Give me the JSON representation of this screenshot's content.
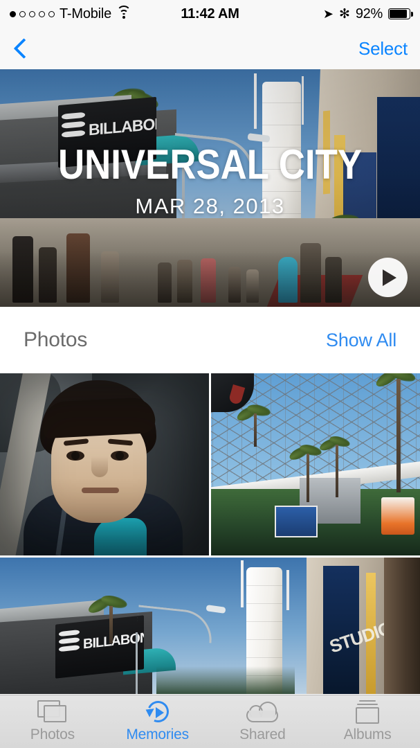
{
  "status_bar": {
    "signal_dots_total": 5,
    "signal_dots_filled": 1,
    "carrier": "T-Mobile",
    "wifi_icon": "wifi-icon",
    "time": "11:42 AM",
    "location_icon": "location-arrow-icon",
    "bluetooth_icon": "bluetooth-icon",
    "battery_percent": "92%",
    "battery_level": 92
  },
  "nav_bar": {
    "back_icon": "chevron-left-icon",
    "select_label": "Select"
  },
  "hero": {
    "title": "UNIVERSAL CITY",
    "date": "MAR 28, 2013",
    "play_icon": "play-icon",
    "sign_text": "BILLABONG"
  },
  "section": {
    "title": "Photos",
    "show_all_label": "Show All"
  },
  "grid": {
    "rows": [
      {
        "tiles": [
          {
            "name": "photo-portrait-selfie",
            "alt": "Portrait selfie in car"
          },
          {
            "name": "photo-geodesic-dome",
            "alt": "Geodesic dome and palm trees"
          }
        ]
      },
      {
        "tiles": [
          {
            "name": "photo-universal-citywalk",
            "alt": "Billabong store and Universal Studios sign"
          }
        ]
      }
    ],
    "tile3_sign_text": "BILLABONG",
    "tile3_studio_text": "STUDIO"
  },
  "tab_bar": {
    "tabs": [
      {
        "label": "Photos",
        "icon": "photos-stack-icon",
        "active": false
      },
      {
        "label": "Memories",
        "icon": "memories-replay-icon",
        "active": true
      },
      {
        "label": "Shared",
        "icon": "cloud-icon",
        "active": false
      },
      {
        "label": "Albums",
        "icon": "albums-stack-icon",
        "active": false
      }
    ]
  },
  "colors": {
    "ios_blue": "#0a84ff",
    "link_blue": "#2f8bf0",
    "tab_inactive": "#9a9a9a",
    "section_title": "#6b6b6b",
    "chrome_bg": "#f8f8f8"
  }
}
